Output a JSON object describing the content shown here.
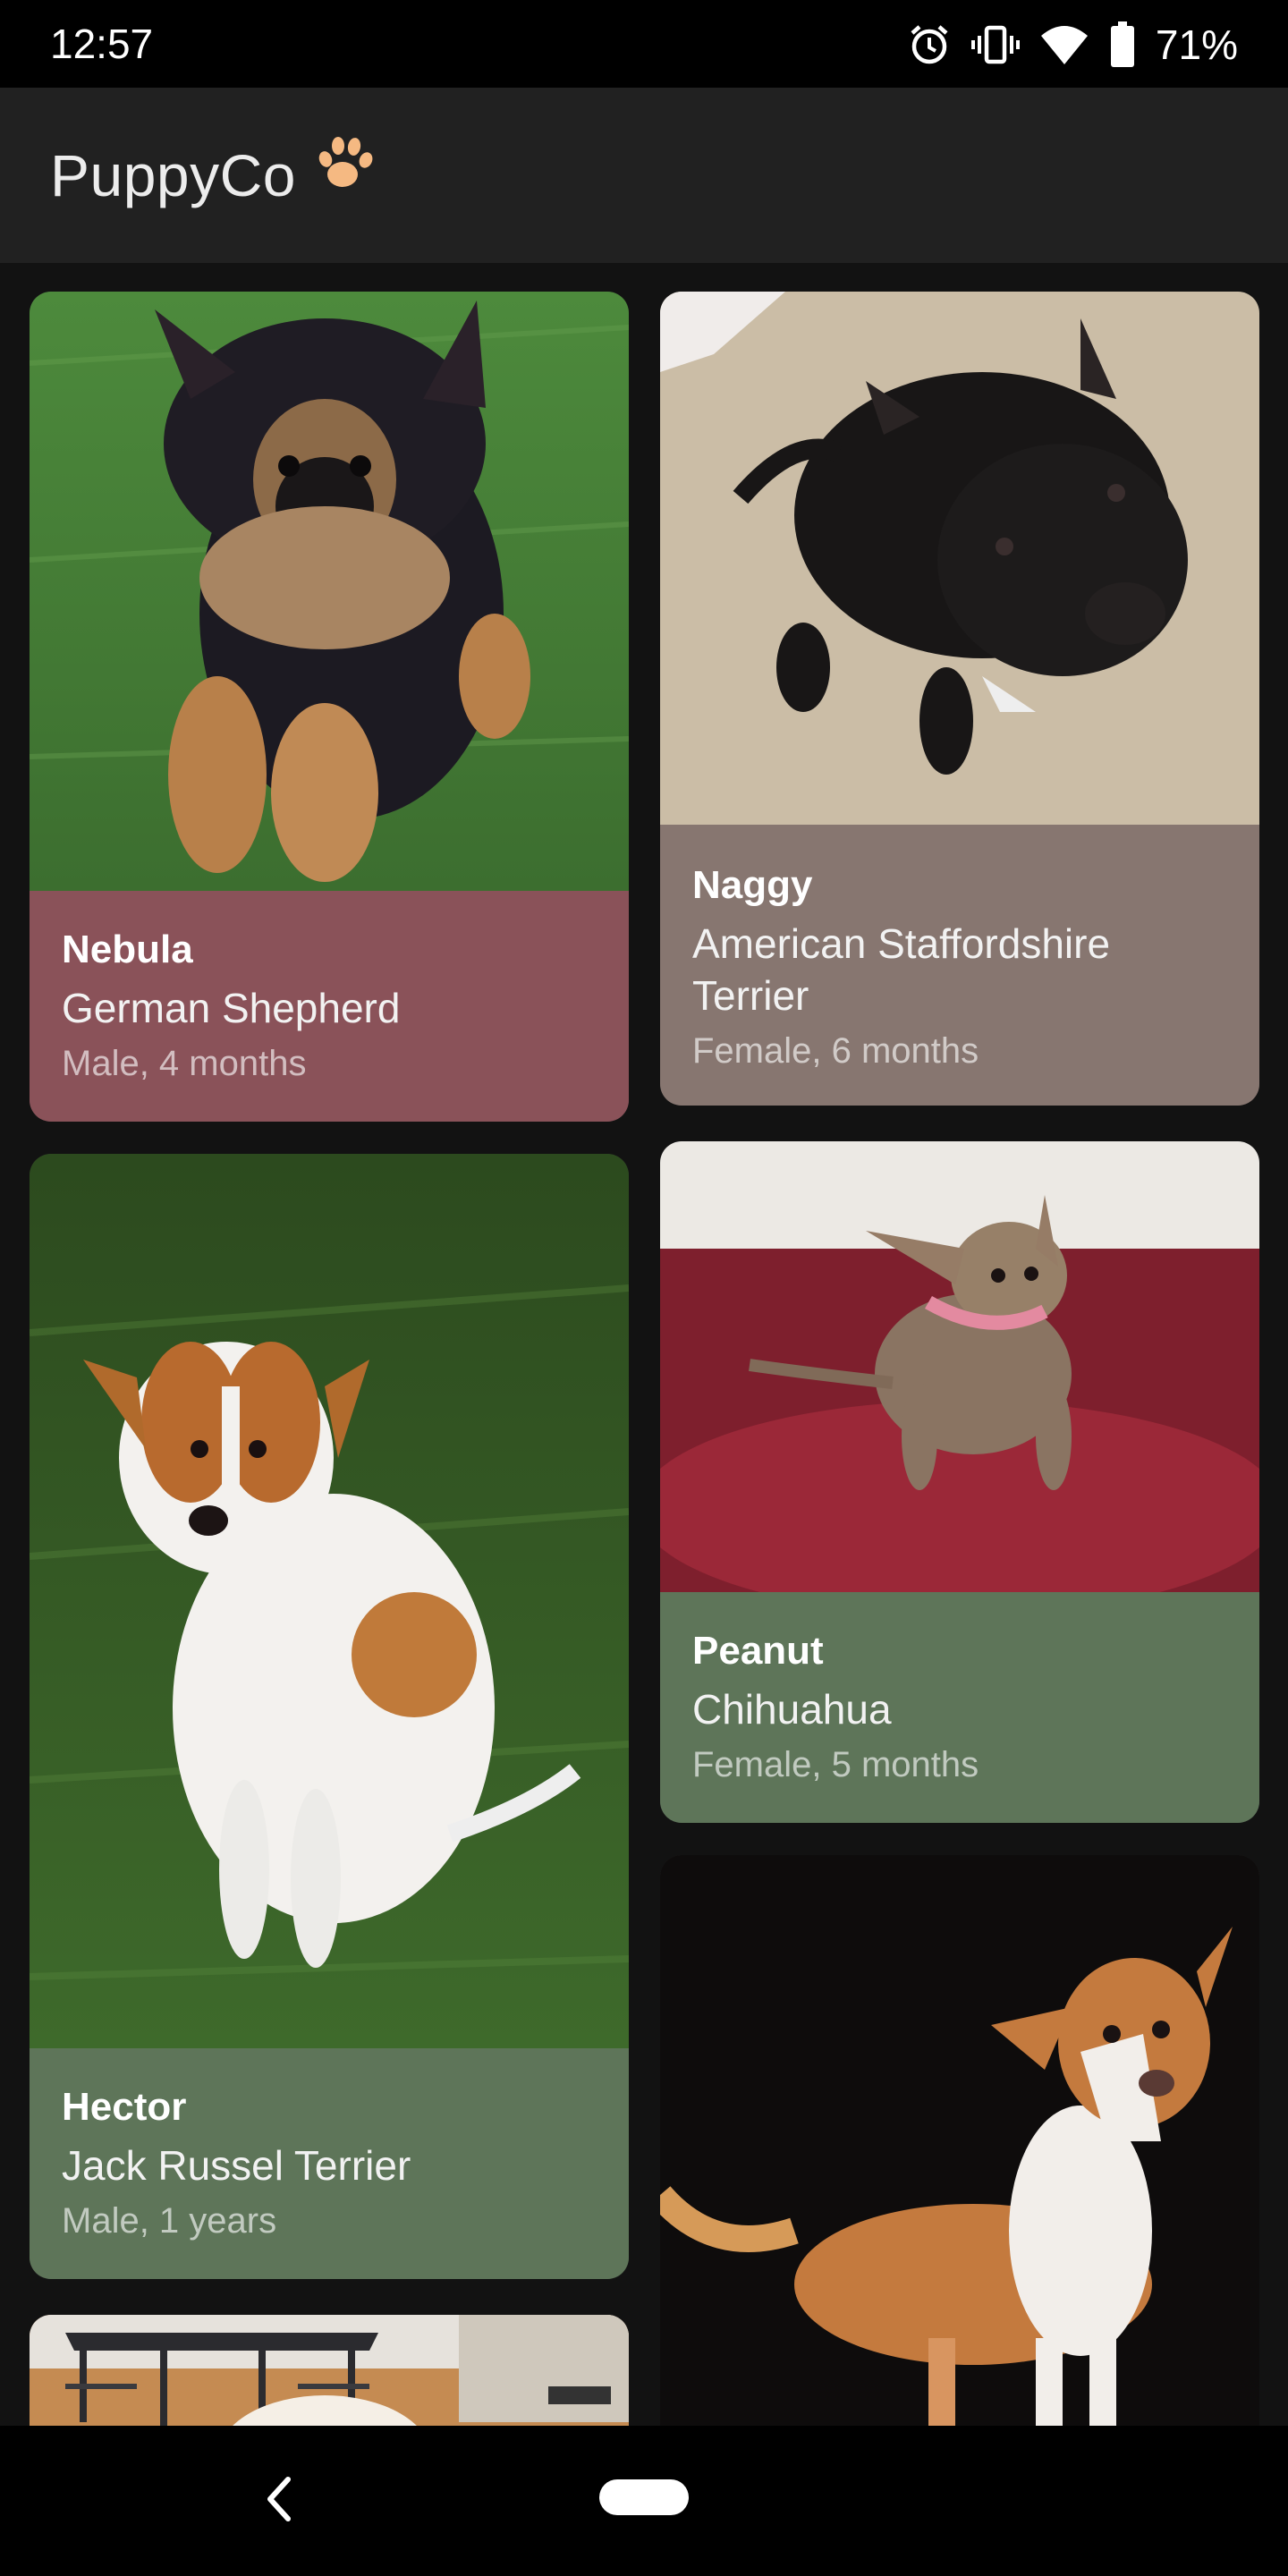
{
  "status_bar": {
    "time": "12:57",
    "battery": "71%",
    "icons": [
      "alarm-icon",
      "vibrate-icon",
      "wifi-icon",
      "battery-icon"
    ]
  },
  "app_bar": {
    "title": "PuppyCo",
    "logo_icon": "paw-icon",
    "logo_color": "#f5b982"
  },
  "puppies": [
    {
      "name": "Nebula",
      "breed": "German Shepherd",
      "meta": "Male, 4 months",
      "card_color": "#8a5259"
    },
    {
      "name": "Naggy",
      "breed": "American Staffordshire Terrier",
      "meta": "Female, 6 months",
      "card_color": "#877670"
    },
    {
      "name": "Hector",
      "breed": "Jack Russel Terrier",
      "meta": "Male, 1 years",
      "card_color": "#5e7559"
    },
    {
      "name": "Peanut",
      "breed": "Chihuahua",
      "meta": "Female, 5 months",
      "card_color": "#5e7559"
    }
  ],
  "nav_bar": {
    "back_icon": "chevron-left-icon",
    "home_icon": "home-pill-icon"
  }
}
